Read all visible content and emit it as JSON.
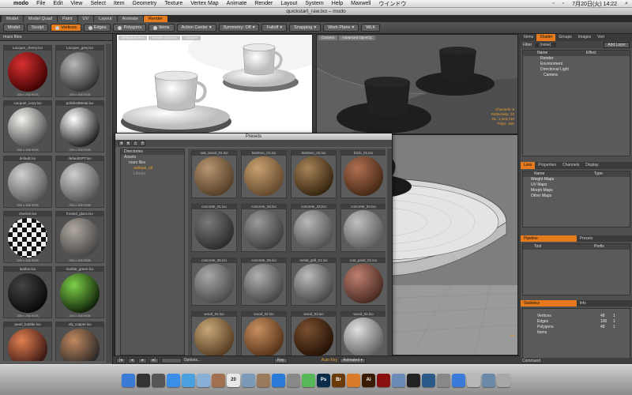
{
  "menubar": {
    "apple": "",
    "items": [
      "modo",
      "File",
      "Edit",
      "View",
      "Select",
      "Item",
      "Geometry",
      "Texture",
      "Vertex Map",
      "Animate",
      "Render",
      "Layout",
      "System",
      "Help",
      "Maxwell",
      "ウインドウ"
    ],
    "clock": "7月20日(火) 14:22"
  },
  "window": {
    "title": "quickstart_raw.lxo – modo"
  },
  "layout_tabs": [
    {
      "label": "Model",
      "active": false
    },
    {
      "label": "Model Quad",
      "active": false
    },
    {
      "label": "Paint",
      "active": false
    },
    {
      "label": "UV",
      "active": false
    },
    {
      "label": "Layout",
      "active": false
    },
    {
      "label": "Animate",
      "active": false
    },
    {
      "label": "Render",
      "active": true
    }
  ],
  "toolbar": {
    "model": "Model",
    "sculpt": "Sculpt",
    "vertices": "Vertices",
    "edges": "Edges",
    "polygons": "Polygons",
    "items": "Items",
    "action_center": "Action Center",
    "symmetry": "Symmetry: Off",
    "falloff": "Falloff",
    "snapping": "Snapping",
    "work_plane": "Work Plane",
    "tool": "WLK"
  },
  "left_panel": {
    "header": "mars files",
    "cells": [
      {
        "label": "Lacquer_cherry.lxo",
        "info": "256 x 256  RGB",
        "c1": "#d83030",
        "c2": "#3a0000"
      },
      {
        "label": "Lacquer_grey.lxo",
        "info": "256 x 256  RGB",
        "c1": "#b8b8b8",
        "c2": "#2a2a2a"
      },
      {
        "label": "Lacquer_ivory.lxo",
        "info": "256 x 256  RGB",
        "c1": "#f2f2ee",
        "c2": "#444"
      },
      {
        "label": "polishedMetal.lxo",
        "info": "256 x 256  RGB",
        "c1": "#ffffff",
        "c2": "#151515"
      },
      {
        "label": "default.lxo",
        "info": "256 x 256  RGB",
        "c1": "#d0d0d0",
        "c2": "#555"
      },
      {
        "label": "defaultGPT.lxo",
        "info": "256 x 256  RGB",
        "c1": "#cfcfcf",
        "c2": "#505050"
      },
      {
        "label": "checker.lxo",
        "info": "256 x 256  RGB",
        "c1": "#f5a040",
        "c2": "#111"
      },
      {
        "label": "frosted_glass.lxo",
        "info": "256 x 256  RGB",
        "c1": "#b0a8a0",
        "c2": "#404040"
      },
      {
        "label": "leather.lxo",
        "info": "256 x 256  RGB",
        "c1": "#444",
        "c2": "#050505"
      },
      {
        "label": "marble_green.lxo",
        "info": "256 x 256  RGB",
        "c1": "#7ed04a",
        "c2": "#0a1a05"
      },
      {
        "label": "pearl_bubble.lxo",
        "info": "256 x 256  RGB",
        "c1": "#e08050",
        "c2": "#301010"
      },
      {
        "label": "obj_copper.lxo",
        "info": "256 x 256  RGB",
        "c1": "#c08860",
        "c2": "#222"
      }
    ]
  },
  "viewport1": {
    "buttons": [
      "Default Scene",
      "Render Camera",
      "Options"
    ]
  },
  "viewport2": {
    "buttons": [
      "Camera",
      "Advanced OpenGL"
    ],
    "stats": [
      "Channels: 9",
      "Reflectivity: 20",
      "GL: 1,344,720",
      "Polys: 16K"
    ]
  },
  "presets": {
    "title": "Presets",
    "tree": [
      "Directories",
      "Assets",
      "mars files",
      "antique_oil",
      "Library"
    ],
    "cells": [
      {
        "label": "oak_wood_01.lxo",
        "c1": "#b89670",
        "c2": "#4a3520"
      },
      {
        "label": "bamboo_01.lxo",
        "c1": "#c8a070",
        "c2": "#5a4025"
      },
      {
        "label": "bamboo_02.lxo",
        "c1": "#a88458",
        "c2": "#2a1a08"
      },
      {
        "label": "brick_01.lxo",
        "c1": "#b07050",
        "c2": "#3a2010"
      },
      {
        "label": "concrete_01.lxo",
        "c1": "#7a7a7a",
        "c2": "#222"
      },
      {
        "label": "concrete_02.lxo",
        "c1": "#9a9a9a",
        "c2": "#333"
      },
      {
        "label": "concrete_03.lxo",
        "c1": "#b8b8b8",
        "c2": "#444"
      },
      {
        "label": "concrete_04.lxo",
        "c1": "#c0c0c0",
        "c2": "#505050"
      },
      {
        "label": "concrete_05.lxo",
        "c1": "#a8a8a8",
        "c2": "#404040"
      },
      {
        "label": "concrete_06.lxo",
        "c1": "#b0b0b0",
        "c2": "#3a3a3a"
      },
      {
        "label": "metal_grill_01.lxo",
        "c1": "#bcbcbc",
        "c2": "#3a3a3a"
      },
      {
        "label": "rust_paint_01.lxo",
        "c1": "#c08070",
        "c2": "#3a2018"
      },
      {
        "label": "wood_01.lxo",
        "c1": "#c8a878",
        "c2": "#4a3018"
      },
      {
        "label": "wood_02.lxo",
        "c1": "#c89060",
        "c2": "#4a2810"
      },
      {
        "label": "wood_03.lxo",
        "c1": "#7a5030",
        "c2": "#1a0a00"
      },
      {
        "label": "wood_04.lxo",
        "c1": "#e0e0e0",
        "c2": "#555"
      }
    ]
  },
  "right_panel": {
    "tabs": [
      {
        "label": "Items",
        "active": false
      },
      {
        "label": "Shader",
        "active": true
      },
      {
        "label": "Groups",
        "active": false
      },
      {
        "label": "Images",
        "active": false
      },
      {
        "label": "Vert",
        "active": false
      }
    ],
    "filter_label": "Filter",
    "filter_value": "(none)",
    "add_layer": "Add Layer",
    "col_name": "Name",
    "col_effect": "Effect",
    "shader_rows": [
      "Render",
      "Environment",
      "Directional Light",
      "Camera"
    ],
    "lists_tabs": [
      {
        "label": "Lists",
        "active": true
      },
      {
        "label": "Properties",
        "active": false
      },
      {
        "label": "Channels",
        "active": false
      },
      {
        "label": "Display",
        "active": false
      }
    ],
    "lists_col_name": "Name",
    "lists_col_type": "Type",
    "lists_rows": [
      "Weight Maps",
      "UV Maps",
      "Morph Maps",
      "Other Maps"
    ],
    "pipeline_label": "Pipeline",
    "presets_label": "Presets",
    "pipeline_cols": [
      "Tool",
      "Prefix"
    ],
    "statistics_label": "Statistics",
    "info_label": "Info",
    "stats_rows": [
      {
        "name": "Vertices",
        "v1": "48",
        "v2": "1"
      },
      {
        "name": "Edges",
        "v1": "100",
        "v2": "1"
      },
      {
        "name": "Polygons",
        "v1": "48",
        "v2": "1"
      },
      {
        "name": "Items",
        "v1": "",
        "v2": ""
      }
    ]
  },
  "timeline": {
    "options": "Options...",
    "key": "Key",
    "auto_key": "Auto Key",
    "animated": "Animated"
  },
  "command": {
    "label": "Command"
  },
  "dock": [
    {
      "name": "finder",
      "c": "#3b7bd8",
      "t": ""
    },
    {
      "name": "dashboard",
      "c": "#333",
      "t": ""
    },
    {
      "name": "expose",
      "c": "#555",
      "t": ""
    },
    {
      "name": "safari",
      "c": "#3a8ee8",
      "t": ""
    },
    {
      "name": "itunes",
      "c": "#4aa0e0",
      "t": ""
    },
    {
      "name": "mail",
      "c": "#8ab0d8",
      "t": ""
    },
    {
      "name": "address-book",
      "c": "#a07050",
      "t": ""
    },
    {
      "name": "ical",
      "c": "#e8e8e8",
      "t": "20"
    },
    {
      "name": "preview",
      "c": "#7a9ab8",
      "t": ""
    },
    {
      "name": "photos",
      "c": "#9a7a5a",
      "t": ""
    },
    {
      "name": "app-store",
      "c": "#2a7ad8",
      "t": ""
    },
    {
      "name": "system-prefs",
      "c": "#888",
      "t": ""
    },
    {
      "name": "messages",
      "c": "#58b858",
      "t": ""
    },
    {
      "name": "photoshop-icon",
      "c": "#0a2a4a",
      "t": "Ps"
    },
    {
      "name": "bridge",
      "c": "#6a3a0a",
      "t": "Br"
    },
    {
      "name": "modo",
      "c": "#d87a2a",
      "t": ""
    },
    {
      "name": "illustrator",
      "c": "#3a1a00",
      "t": "Ai"
    },
    {
      "name": "flash",
      "c": "#8a1010",
      "t": ""
    },
    {
      "name": "finder-2",
      "c": "#6a8ab8",
      "t": ""
    },
    {
      "name": "terminal",
      "c": "#222",
      "t": ""
    },
    {
      "name": "maxwell",
      "c": "#2a5a8a",
      "t": ""
    },
    {
      "name": "app-1",
      "c": "#888",
      "t": ""
    },
    {
      "name": "app-2",
      "c": "#3a7ad8",
      "t": ""
    },
    {
      "name": "app-3",
      "c": "#b8b8b8",
      "t": ""
    },
    {
      "name": "app-4",
      "c": "#6a8aa8",
      "t": ""
    },
    {
      "name": "trash",
      "c": "#a8a8a8",
      "t": ""
    }
  ]
}
